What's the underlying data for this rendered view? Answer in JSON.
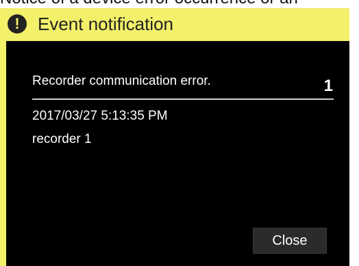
{
  "caption": {
    "text": "Notice of a device error occurrence or an"
  },
  "dialog": {
    "title": "Event notification",
    "icon": "exclamation-icon",
    "event": {
      "name": "Recorder communication error.",
      "count": "1",
      "timestamp": "2017/03/27 5:13:35 PM",
      "device": "recorder 1"
    },
    "close_label": "Close"
  },
  "colors": {
    "title_bar": "#f3f06a",
    "content_background": "#000000",
    "button_background": "#2b2b2b",
    "text_on_dark": "#ffffff"
  }
}
